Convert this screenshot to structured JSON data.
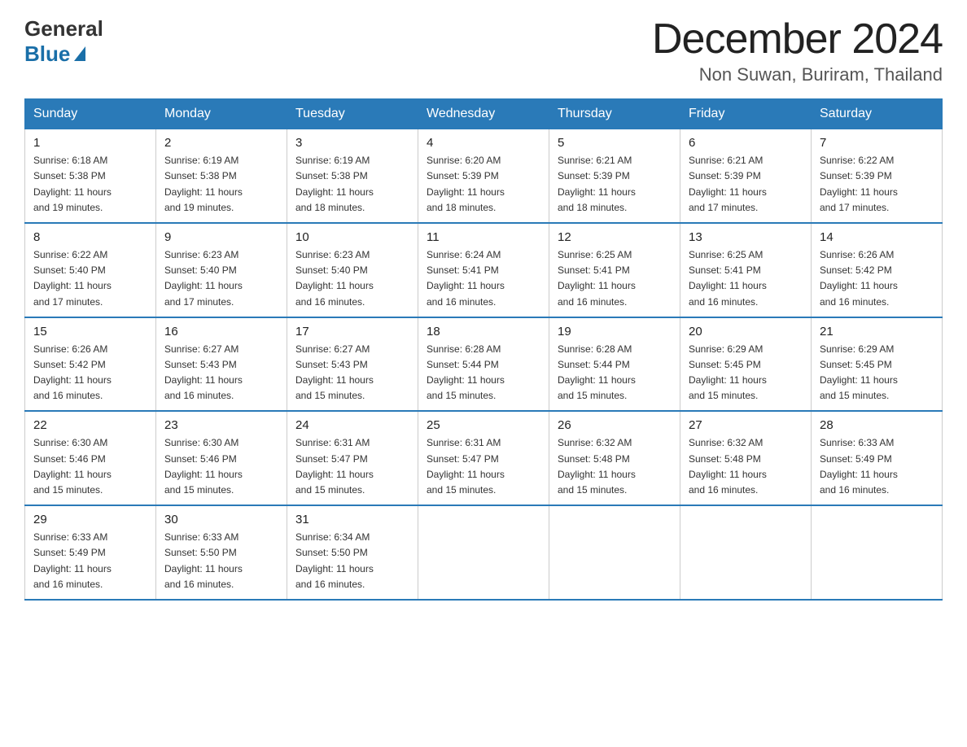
{
  "header": {
    "logo_line1": "General",
    "logo_line2": "Blue",
    "month_year": "December 2024",
    "location": "Non Suwan, Buriram, Thailand"
  },
  "days_of_week": [
    "Sunday",
    "Monday",
    "Tuesday",
    "Wednesday",
    "Thursday",
    "Friday",
    "Saturday"
  ],
  "weeks": [
    [
      {
        "day": "1",
        "sunrise": "6:18 AM",
        "sunset": "5:38 PM",
        "daylight": "11 hours and 19 minutes."
      },
      {
        "day": "2",
        "sunrise": "6:19 AM",
        "sunset": "5:38 PM",
        "daylight": "11 hours and 19 minutes."
      },
      {
        "day": "3",
        "sunrise": "6:19 AM",
        "sunset": "5:38 PM",
        "daylight": "11 hours and 18 minutes."
      },
      {
        "day": "4",
        "sunrise": "6:20 AM",
        "sunset": "5:39 PM",
        "daylight": "11 hours and 18 minutes."
      },
      {
        "day": "5",
        "sunrise": "6:21 AM",
        "sunset": "5:39 PM",
        "daylight": "11 hours and 18 minutes."
      },
      {
        "day": "6",
        "sunrise": "6:21 AM",
        "sunset": "5:39 PM",
        "daylight": "11 hours and 17 minutes."
      },
      {
        "day": "7",
        "sunrise": "6:22 AM",
        "sunset": "5:39 PM",
        "daylight": "11 hours and 17 minutes."
      }
    ],
    [
      {
        "day": "8",
        "sunrise": "6:22 AM",
        "sunset": "5:40 PM",
        "daylight": "11 hours and 17 minutes."
      },
      {
        "day": "9",
        "sunrise": "6:23 AM",
        "sunset": "5:40 PM",
        "daylight": "11 hours and 17 minutes."
      },
      {
        "day": "10",
        "sunrise": "6:23 AM",
        "sunset": "5:40 PM",
        "daylight": "11 hours and 16 minutes."
      },
      {
        "day": "11",
        "sunrise": "6:24 AM",
        "sunset": "5:41 PM",
        "daylight": "11 hours and 16 minutes."
      },
      {
        "day": "12",
        "sunrise": "6:25 AM",
        "sunset": "5:41 PM",
        "daylight": "11 hours and 16 minutes."
      },
      {
        "day": "13",
        "sunrise": "6:25 AM",
        "sunset": "5:41 PM",
        "daylight": "11 hours and 16 minutes."
      },
      {
        "day": "14",
        "sunrise": "6:26 AM",
        "sunset": "5:42 PM",
        "daylight": "11 hours and 16 minutes."
      }
    ],
    [
      {
        "day": "15",
        "sunrise": "6:26 AM",
        "sunset": "5:42 PM",
        "daylight": "11 hours and 16 minutes."
      },
      {
        "day": "16",
        "sunrise": "6:27 AM",
        "sunset": "5:43 PM",
        "daylight": "11 hours and 16 minutes."
      },
      {
        "day": "17",
        "sunrise": "6:27 AM",
        "sunset": "5:43 PM",
        "daylight": "11 hours and 15 minutes."
      },
      {
        "day": "18",
        "sunrise": "6:28 AM",
        "sunset": "5:44 PM",
        "daylight": "11 hours and 15 minutes."
      },
      {
        "day": "19",
        "sunrise": "6:28 AM",
        "sunset": "5:44 PM",
        "daylight": "11 hours and 15 minutes."
      },
      {
        "day": "20",
        "sunrise": "6:29 AM",
        "sunset": "5:45 PM",
        "daylight": "11 hours and 15 minutes."
      },
      {
        "day": "21",
        "sunrise": "6:29 AM",
        "sunset": "5:45 PM",
        "daylight": "11 hours and 15 minutes."
      }
    ],
    [
      {
        "day": "22",
        "sunrise": "6:30 AM",
        "sunset": "5:46 PM",
        "daylight": "11 hours and 15 minutes."
      },
      {
        "day": "23",
        "sunrise": "6:30 AM",
        "sunset": "5:46 PM",
        "daylight": "11 hours and 15 minutes."
      },
      {
        "day": "24",
        "sunrise": "6:31 AM",
        "sunset": "5:47 PM",
        "daylight": "11 hours and 15 minutes."
      },
      {
        "day": "25",
        "sunrise": "6:31 AM",
        "sunset": "5:47 PM",
        "daylight": "11 hours and 15 minutes."
      },
      {
        "day": "26",
        "sunrise": "6:32 AM",
        "sunset": "5:48 PM",
        "daylight": "11 hours and 15 minutes."
      },
      {
        "day": "27",
        "sunrise": "6:32 AM",
        "sunset": "5:48 PM",
        "daylight": "11 hours and 16 minutes."
      },
      {
        "day": "28",
        "sunrise": "6:33 AM",
        "sunset": "5:49 PM",
        "daylight": "11 hours and 16 minutes."
      }
    ],
    [
      {
        "day": "29",
        "sunrise": "6:33 AM",
        "sunset": "5:49 PM",
        "daylight": "11 hours and 16 minutes."
      },
      {
        "day": "30",
        "sunrise": "6:33 AM",
        "sunset": "5:50 PM",
        "daylight": "11 hours and 16 minutes."
      },
      {
        "day": "31",
        "sunrise": "6:34 AM",
        "sunset": "5:50 PM",
        "daylight": "11 hours and 16 minutes."
      },
      null,
      null,
      null,
      null
    ]
  ],
  "label_sunrise": "Sunrise:",
  "label_sunset": "Sunset:",
  "label_daylight": "Daylight:"
}
